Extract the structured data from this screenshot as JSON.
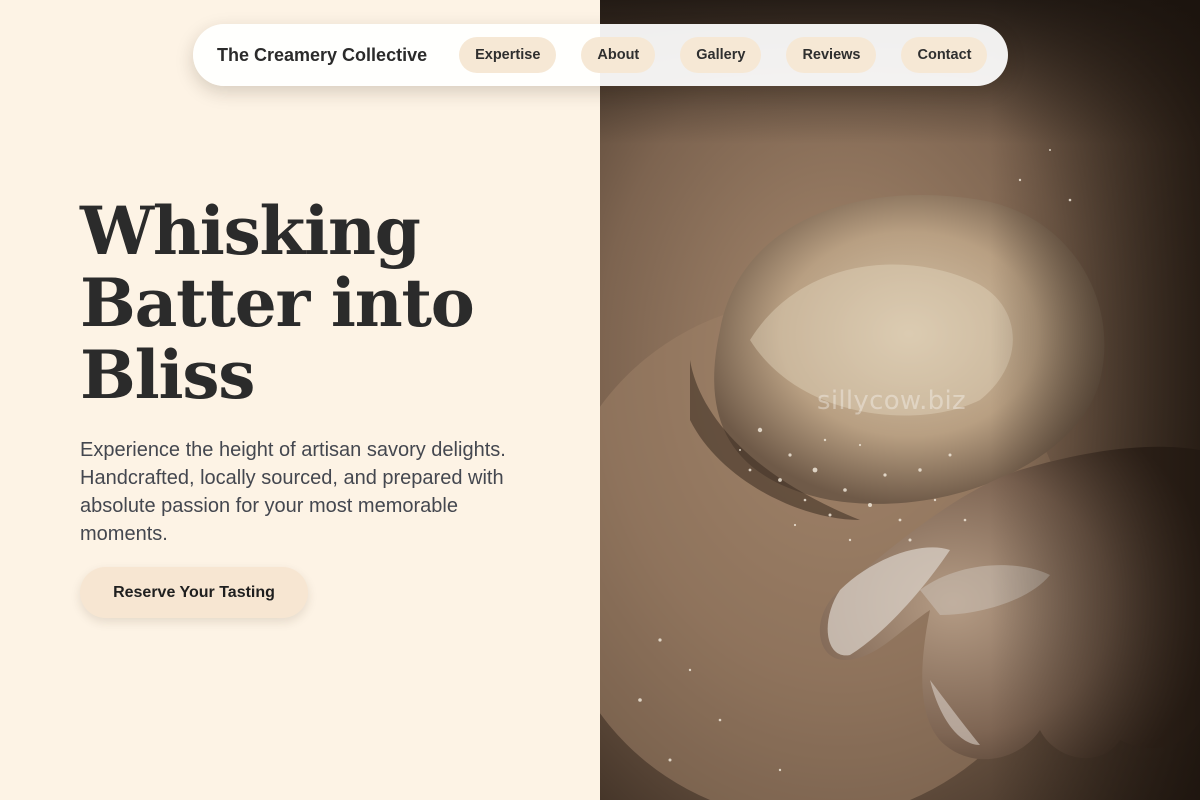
{
  "brand": {
    "name": "The Creamery Collective"
  },
  "nav": {
    "items": [
      {
        "label": "Expertise"
      },
      {
        "label": "About"
      },
      {
        "label": "Gallery"
      },
      {
        "label": "Reviews"
      },
      {
        "label": "Contact"
      }
    ]
  },
  "hero": {
    "title_lines": [
      "Whisking",
      "Batter into",
      "Bliss"
    ],
    "description": "Experience the height of artisan savory delights. Handcrafted, locally sourced, and prepared with absolute passion for your most memorable moments.",
    "cta_label": "Reserve Your Tasting"
  },
  "photo": {
    "watermark": "sillycow.biz"
  },
  "colors": {
    "background": "#fdf3e5",
    "nav_pill": "#f6e8d5",
    "cta": "#f7e6d2",
    "heading": "#2b2b2b",
    "body_text": "#44474f"
  }
}
